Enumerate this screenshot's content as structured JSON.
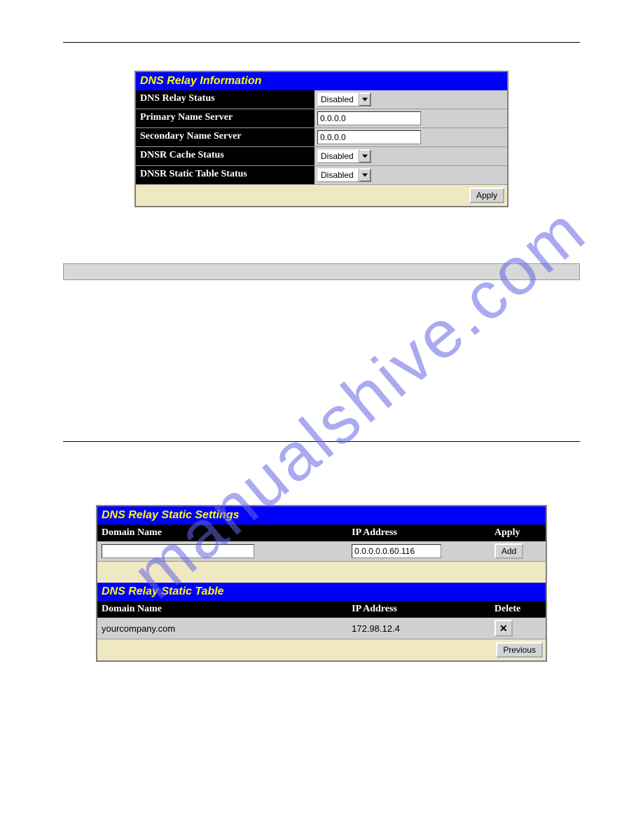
{
  "watermark": "manualshive.com",
  "panel1": {
    "title": "DNS Relay Information",
    "rows": {
      "relay_status": {
        "label": "DNS Relay Status",
        "value": "Disabled"
      },
      "primary": {
        "label": "Primary Name Server",
        "value": "0.0.0.0"
      },
      "secondary": {
        "label": "Secondary Name Server",
        "value": "0.0.0.0"
      },
      "cache": {
        "label": "DNSR Cache Status",
        "value": "Disabled"
      },
      "static_status": {
        "label": "DNSR Static Table Status",
        "value": "Disabled"
      }
    },
    "apply": "Apply"
  },
  "panel2": {
    "title": "DNS Relay Static Settings",
    "headers": {
      "domain": "Domain Name",
      "ip": "IP Address",
      "apply": "Apply"
    },
    "input_row": {
      "domain": "",
      "ip": "0.0.0.0.0.60.116"
    },
    "add": "Add"
  },
  "panel3": {
    "title": "DNS Relay Static Table",
    "headers": {
      "domain": "Domain Name",
      "ip": "IP Address",
      "delete": "Delete"
    },
    "row": {
      "domain": "yourcompany.com",
      "ip": "172.98.12.4"
    },
    "previous": "Previous"
  }
}
